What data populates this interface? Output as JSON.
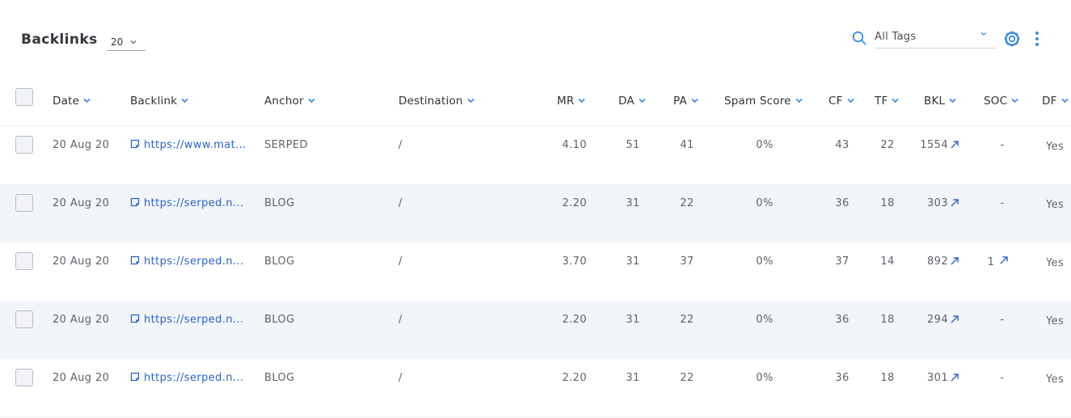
{
  "header": {
    "title": "Backlinks",
    "page_size": "20",
    "tags_select": "All Tags"
  },
  "table": {
    "columns": [
      {
        "key": "date",
        "label": "Date"
      },
      {
        "key": "backlink",
        "label": "Backlink"
      },
      {
        "key": "anchor",
        "label": "Anchor"
      },
      {
        "key": "destination",
        "label": "Destination"
      },
      {
        "key": "mr",
        "label": "MR"
      },
      {
        "key": "da",
        "label": "DA"
      },
      {
        "key": "pa",
        "label": "PA"
      },
      {
        "key": "spam",
        "label": "Spam Score"
      },
      {
        "key": "cf",
        "label": "CF"
      },
      {
        "key": "tf",
        "label": "TF"
      },
      {
        "key": "bkl",
        "label": "BKL"
      },
      {
        "key": "soc",
        "label": "SOC"
      },
      {
        "key": "df",
        "label": "DF"
      }
    ],
    "rows": [
      {
        "date": "20 Aug 20",
        "backlink": "https://www.mat...",
        "anchor": "SERPED",
        "destination": "/",
        "mr": "4.10",
        "da": "51",
        "pa": "41",
        "spam": "0%",
        "cf": "43",
        "tf": "22",
        "bkl": "1554",
        "soc": "-",
        "soc_link": false,
        "df": "Yes"
      },
      {
        "date": "20 Aug 20",
        "backlink": "https://serped.n...",
        "anchor": "BLOG",
        "destination": "/",
        "mr": "2.20",
        "da": "31",
        "pa": "22",
        "spam": "0%",
        "cf": "36",
        "tf": "18",
        "bkl": "303",
        "soc": "-",
        "soc_link": false,
        "df": "Yes"
      },
      {
        "date": "20 Aug 20",
        "backlink": "https://serped.n...",
        "anchor": "BLOG",
        "destination": "/",
        "mr": "3.70",
        "da": "31",
        "pa": "37",
        "spam": "0%",
        "cf": "37",
        "tf": "14",
        "bkl": "892",
        "soc": "1",
        "soc_link": true,
        "df": "Yes"
      },
      {
        "date": "20 Aug 20",
        "backlink": "https://serped.n...",
        "anchor": "BLOG",
        "destination": "/",
        "mr": "2.20",
        "da": "31",
        "pa": "22",
        "spam": "0%",
        "cf": "36",
        "tf": "18",
        "bkl": "294",
        "soc": "-",
        "soc_link": false,
        "df": "Yes"
      },
      {
        "date": "20 Aug 20",
        "backlink": "https://serped.n...",
        "anchor": "BLOG",
        "destination": "/",
        "mr": "2.20",
        "da": "31",
        "pa": "22",
        "spam": "0%",
        "cf": "36",
        "tf": "18",
        "bkl": "301",
        "soc": "-",
        "soc_link": false,
        "df": "Yes"
      }
    ]
  },
  "colors": {
    "accent": "#3f8ee0",
    "link": "#2a62c9",
    "row_alt_bg": "#f2f5fa"
  }
}
